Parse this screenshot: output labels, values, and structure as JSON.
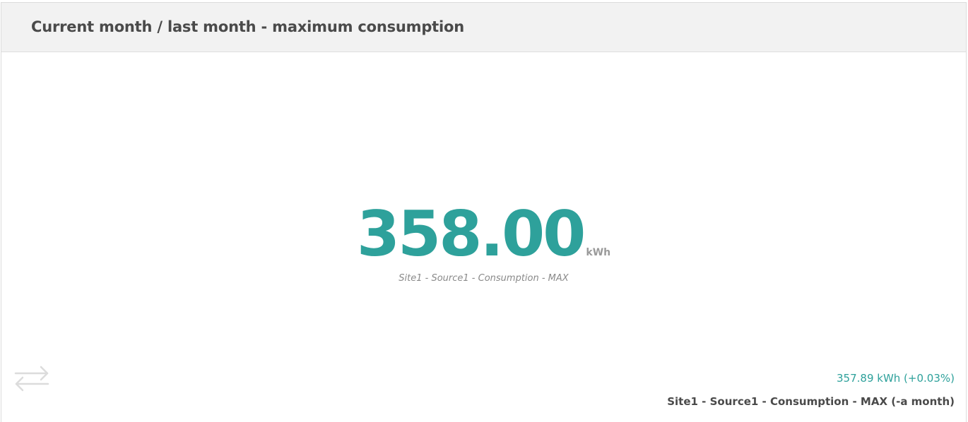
{
  "widget": {
    "title": "Current month / last month - maximum consumption",
    "main": {
      "value": "358.00",
      "unit": "kWh",
      "label": "Site1 - Source1 - Consumption - MAX"
    },
    "comparison": {
      "icon": "swap-arrows-icon",
      "value_text": "357.89 kWh (+0.03%)",
      "label": "Site1 - Source1 - Consumption - MAX (-a month)"
    },
    "colors": {
      "accent": "#2ea19b",
      "header_bg": "#f2f2f2",
      "title_text": "#4a4a4a",
      "muted_text": "#8a8a8a",
      "icon": "#dcdcdc"
    }
  }
}
